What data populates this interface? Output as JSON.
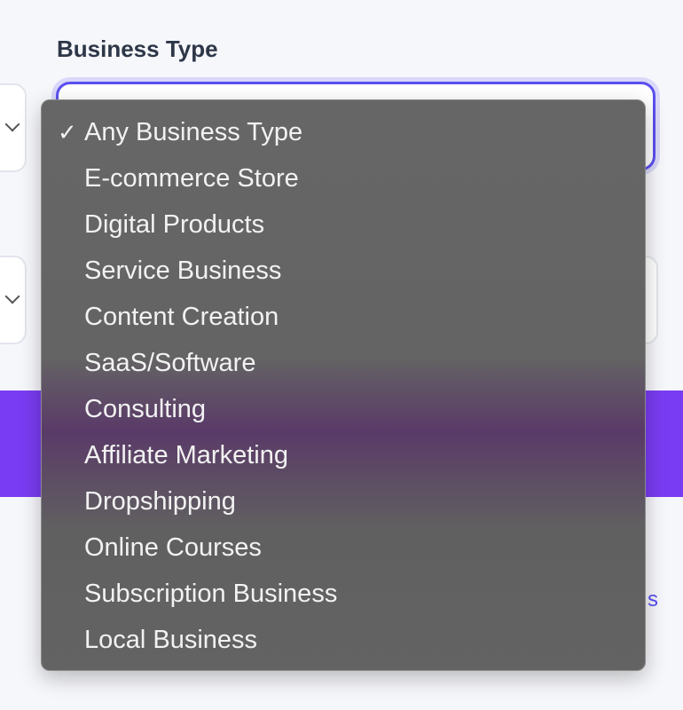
{
  "field": {
    "label": "Business Type"
  },
  "background": {
    "link_peek": "s"
  },
  "dropdown": {
    "selected": "Any Business Type",
    "check_mark": "✓",
    "options": [
      "Any Business Type",
      "E-commerce Store",
      "Digital Products",
      "Service Business",
      "Content Creation",
      "SaaS/Software",
      "Consulting",
      "Affiliate Marketing",
      "Dropshipping",
      "Online Courses",
      "Subscription Business",
      "Local Business"
    ]
  },
  "icons": {
    "check": "checkmark-icon",
    "chevron": "chevron-down-icon"
  },
  "colors": {
    "accent": "#5b4ff0",
    "band": "#7a3cf2",
    "label": "#2d3748"
  }
}
